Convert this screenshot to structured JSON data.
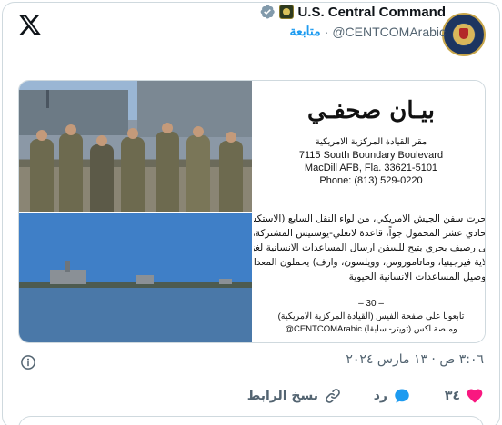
{
  "account": {
    "name": "U.S. Central Command",
    "handle": "@CENTCOMArabic",
    "separator": "·",
    "follow_label": "متابعة"
  },
  "statement": {
    "title": "بيـان صحفـي",
    "subtitle": "مقر القيادة المركزية الامريكية",
    "address1": "7115 South Boundary Boulevard",
    "address2": "MacDill AFB, Fla. 33621-5101",
    "phone": "Phone: (813) 529-0220",
    "body": [
      "أبحرت سفن الجيش الامريكي، من لواء النقل السابع (الاستكشافي)",
      "الحادي عشر المحمول جواً، قاعدة لانغلي-يوستيس المشتركة،",
      "إلى رصيف بحري يتيح للسفن ارسال المساعدات الانسانية لغزة. الص",
      "ولاية فيرجينيا، وماتاموروس، وويلسون، وارف) يحملون المعدات",
      "لتوصيل المساعدات الانسانية الحيوية",
      ""
    ],
    "separator": "– 30 –",
    "follow_line1": "تابعونا على صفحة الفيس (القيادة المركزية الامريكية)",
    "follow_line2": "ومنصة اكس (تويتر- سابقا) CENTCOMArabic@"
  },
  "timestamp": "٣:٠٦ ص · ١٣ مارس ٢٠٢٤",
  "actions": {
    "likes": "٣٤",
    "reply_label": "رد",
    "copy_link_label": "نسخ الرابط"
  },
  "colors": {
    "accent": "#1d9bf0",
    "like": "#f91880",
    "muted": "#536471"
  }
}
